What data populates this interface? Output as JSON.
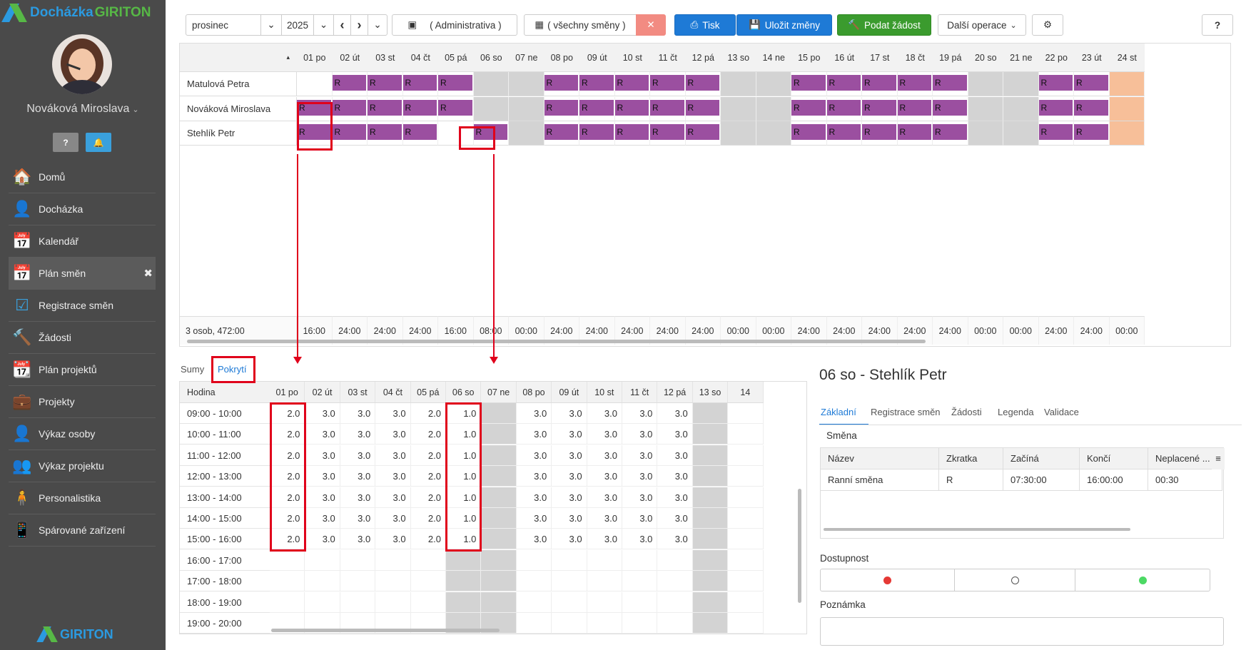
{
  "app": {
    "logo_text_1": "Docházka",
    "logo_text_2": "GIRITON",
    "footer_logo": "GIRITON"
  },
  "user": {
    "name": "Nováková Miroslava",
    "help": "?",
    "notif": "🔔"
  },
  "menu": [
    {
      "label": "Domů",
      "icon": "home-icon",
      "glyph": "🏠"
    },
    {
      "label": "Docházka",
      "icon": "person-icon",
      "glyph": "👤"
    },
    {
      "label": "Kalendář",
      "icon": "calendar-icon",
      "glyph": "📅"
    },
    {
      "label": "Plán směn",
      "icon": "calendar-grid-icon",
      "glyph": "📅",
      "active": true,
      "close": "✖"
    },
    {
      "label": "Registrace směn",
      "icon": "calendar-check-icon",
      "glyph": "☑"
    },
    {
      "label": "Žádosti",
      "icon": "gavel-icon",
      "glyph": "🔨"
    },
    {
      "label": "Plán projektů",
      "icon": "calendar-orange-icon",
      "glyph": "📆"
    },
    {
      "label": "Projekty",
      "icon": "briefcase-icon",
      "glyph": "💼"
    },
    {
      "label": "Výkaz osoby",
      "icon": "person-orange-icon",
      "glyph": "👤"
    },
    {
      "label": "Výkaz projektu",
      "icon": "group-icon",
      "glyph": "👥"
    },
    {
      "label": "Personalistika",
      "icon": "person-green-icon",
      "glyph": "🧍"
    },
    {
      "label": "Spárované zařízení",
      "icon": "mobile-icon",
      "glyph": "📱"
    }
  ],
  "toolbar": {
    "month": "prosinec",
    "year": "2025",
    "dept": "( Administrativa )",
    "shifts": "( všechny směny )",
    "clear": "✕",
    "print": "Tisk",
    "save": "Uložit změny",
    "submit": "Podat žádost",
    "more": "Další operace",
    "gear": "⚙",
    "help": "?",
    "prev": "‹",
    "next": "›",
    "dd": "⌄",
    "sort": "▴"
  },
  "days": [
    "01 po",
    "02 út",
    "03 st",
    "04 čt",
    "05 pá",
    "06 so",
    "07 ne",
    "08 po",
    "09 út",
    "10 st",
    "11 čt",
    "12 pá",
    "13 so",
    "14 ne",
    "15 po",
    "16 út",
    "17 st",
    "18 čt",
    "19 pá",
    "20 so",
    "21 ne",
    "22 po",
    "23 út",
    "24 st"
  ],
  "employees": [
    {
      "name": "Matulová Petra",
      "shifts": [
        "",
        "R",
        "R",
        "R",
        "R",
        "",
        "",
        "R",
        "R",
        "R",
        "R",
        "R",
        "",
        "",
        "R",
        "R",
        "R",
        "R",
        "R",
        "",
        "",
        "R",
        "R",
        ""
      ]
    },
    {
      "name": "Nováková Miroslava",
      "shifts": [
        "R",
        "R",
        "R",
        "R",
        "R",
        "",
        "",
        "R",
        "R",
        "R",
        "R",
        "R",
        "",
        "",
        "R",
        "R",
        "R",
        "R",
        "R",
        "",
        "",
        "R",
        "R",
        ""
      ]
    },
    {
      "name": "Stehlík Petr",
      "shifts": [
        "R",
        "R",
        "R",
        "R",
        "",
        "R",
        "",
        "R",
        "R",
        "R",
        "R",
        "R",
        "",
        "",
        "R",
        "R",
        "R",
        "R",
        "R",
        "",
        "",
        "R",
        "R",
        ""
      ]
    }
  ],
  "summary": {
    "label": "3 osob, 472:00",
    "values": [
      "16:00",
      "24:00",
      "24:00",
      "24:00",
      "16:00",
      "08:00",
      "00:00",
      "24:00",
      "24:00",
      "24:00",
      "24:00",
      "24:00",
      "00:00",
      "00:00",
      "24:00",
      "24:00",
      "24:00",
      "24:00",
      "24:00",
      "00:00",
      "00:00",
      "24:00",
      "24:00",
      "00:00"
    ]
  },
  "lower_tabs": {
    "sumy": "Sumy",
    "pokryti": "Pokrytí"
  },
  "coverage": {
    "header": "Hodina",
    "days": [
      "01 po",
      "02 út",
      "03 st",
      "04 čt",
      "05 pá",
      "06 so",
      "07 ne",
      "08 po",
      "09 út",
      "10 st",
      "11 čt",
      "12 pá",
      "13 so",
      "14"
    ],
    "rows": [
      {
        "hour": "09:00 - 10:00",
        "values": [
          "2.0",
          "3.0",
          "3.0",
          "3.0",
          "2.0",
          "1.0",
          "",
          "3.0",
          "3.0",
          "3.0",
          "3.0",
          "3.0",
          "",
          ""
        ]
      },
      {
        "hour": "10:00 - 11:00",
        "values": [
          "2.0",
          "3.0",
          "3.0",
          "3.0",
          "2.0",
          "1.0",
          "",
          "3.0",
          "3.0",
          "3.0",
          "3.0",
          "3.0",
          "",
          ""
        ]
      },
      {
        "hour": "11:00 - 12:00",
        "values": [
          "2.0",
          "3.0",
          "3.0",
          "3.0",
          "2.0",
          "1.0",
          "",
          "3.0",
          "3.0",
          "3.0",
          "3.0",
          "3.0",
          "",
          ""
        ]
      },
      {
        "hour": "12:00 - 13:00",
        "values": [
          "2.0",
          "3.0",
          "3.0",
          "3.0",
          "2.0",
          "1.0",
          "",
          "3.0",
          "3.0",
          "3.0",
          "3.0",
          "3.0",
          "",
          ""
        ]
      },
      {
        "hour": "13:00 - 14:00",
        "values": [
          "2.0",
          "3.0",
          "3.0",
          "3.0",
          "2.0",
          "1.0",
          "",
          "3.0",
          "3.0",
          "3.0",
          "3.0",
          "3.0",
          "",
          ""
        ]
      },
      {
        "hour": "14:00 - 15:00",
        "values": [
          "2.0",
          "3.0",
          "3.0",
          "3.0",
          "2.0",
          "1.0",
          "",
          "3.0",
          "3.0",
          "3.0",
          "3.0",
          "3.0",
          "",
          ""
        ]
      },
      {
        "hour": "15:00 - 16:00",
        "values": [
          "2.0",
          "3.0",
          "3.0",
          "3.0",
          "2.0",
          "1.0",
          "",
          "3.0",
          "3.0",
          "3.0",
          "3.0",
          "3.0",
          "",
          ""
        ]
      },
      {
        "hour": "16:00 - 17:00",
        "values": [
          "",
          "",
          "",
          "",
          "",
          "",
          "",
          "",
          "",
          "",
          "",
          "",
          "",
          ""
        ]
      },
      {
        "hour": "17:00 - 18:00",
        "values": [
          "",
          "",
          "",
          "",
          "",
          "",
          "",
          "",
          "",
          "",
          "",
          "",
          "",
          ""
        ]
      },
      {
        "hour": "18:00 - 19:00",
        "values": [
          "",
          "",
          "",
          "",
          "",
          "",
          "",
          "",
          "",
          "",
          "",
          "",
          "",
          ""
        ]
      },
      {
        "hour": "19:00 - 20:00",
        "values": [
          "",
          "",
          "",
          "",
          "",
          "",
          "",
          "",
          "",
          "",
          "",
          "",
          "",
          ""
        ]
      }
    ]
  },
  "detail": {
    "title": "06 so - Stehlík Petr",
    "tabs": [
      "Základní",
      "Registrace směn",
      "Žádosti",
      "Legenda",
      "Validace"
    ],
    "shift_section": "Směna",
    "columns": [
      "Název",
      "Zkratka",
      "Začíná",
      "Končí",
      "Neplacené ..."
    ],
    "row": [
      "Ranní směna",
      "R",
      "07:30:00",
      "16:00:00",
      "00:30"
    ],
    "col_menu": "≡",
    "availability": "Dostupnost",
    "note": "Poznámka"
  },
  "colors": {
    "shift": "#9b4fa0",
    "weekend": "#d3d3d3",
    "holiday": "#f7bf99",
    "highlight": "#e0001b",
    "accent": "#1e7ad6"
  }
}
